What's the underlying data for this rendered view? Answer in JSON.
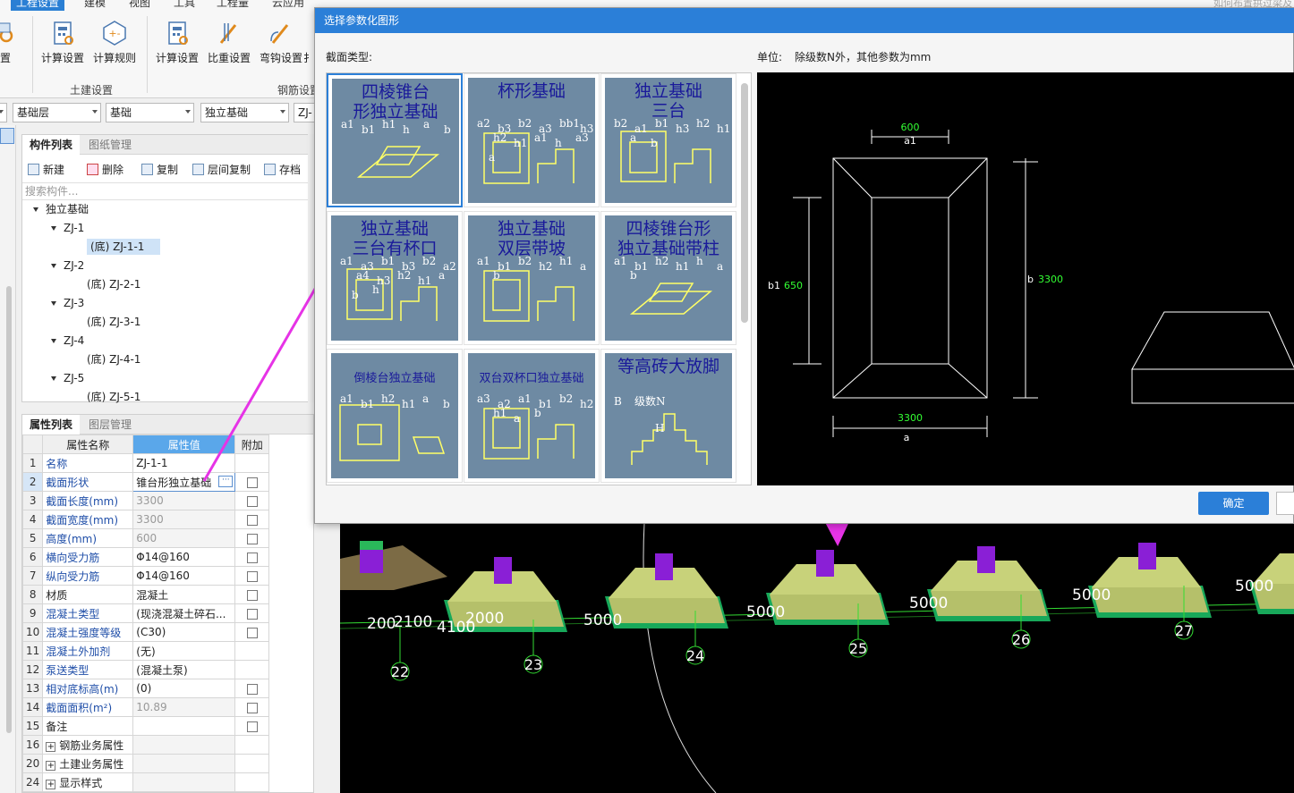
{
  "ribbon": {
    "tabs": [
      "工程设置",
      "建模",
      "视图",
      "工具",
      "工程量",
      "云应用"
    ],
    "active_tab": "工程设置",
    "partial_left": "设置",
    "buttons": [
      "计算设置",
      "计算规则",
      "计算设置",
      "比重设置",
      "弯钩设置",
      "扌"
    ],
    "group_tujian": "土建设置",
    "group_gangjin": "钢筋设置",
    "search_hint": "如何布置拱过梁及"
  },
  "combos": [
    "基础层",
    "基础",
    "独立基础",
    "ZJ-"
  ],
  "component_panel": {
    "tabs": [
      "构件列表",
      "图纸管理"
    ],
    "toolbar": [
      "新建",
      "删除",
      "复制",
      "层间复制",
      "存档"
    ],
    "search_placeholder": "搜索构件...",
    "tree": [
      {
        "label": "独立基础",
        "level": 0
      },
      {
        "label": "ZJ-1",
        "level": 1
      },
      {
        "label": "(底)  ZJ-1-1",
        "level": 2,
        "selected": true
      },
      {
        "label": "ZJ-2",
        "level": 1
      },
      {
        "label": "(底)  ZJ-2-1",
        "level": 2
      },
      {
        "label": "ZJ-3",
        "level": 1
      },
      {
        "label": "(底)  ZJ-3-1",
        "level": 2
      },
      {
        "label": "ZJ-4",
        "level": 1
      },
      {
        "label": "(底)  ZJ-4-1",
        "level": 2
      },
      {
        "label": "ZJ-5",
        "level": 1
      },
      {
        "label": "(底)  ZJ-5-1",
        "level": 2
      }
    ]
  },
  "property_panel": {
    "tabs": [
      "属性列表",
      "图层管理"
    ],
    "headers": [
      "属性名称",
      "属性值",
      "附加"
    ],
    "rows": [
      {
        "n": "1",
        "name": "名称",
        "value": "ZJ-1-1",
        "blue": true,
        "check": false,
        "gray": false
      },
      {
        "n": "2",
        "name": "截面形状",
        "value": "锥台形独立基础",
        "blue": true,
        "check": true,
        "gray": false
      },
      {
        "n": "3",
        "name": "截面长度(mm)",
        "value": "3300",
        "blue": true,
        "check": true,
        "gray": true
      },
      {
        "n": "4",
        "name": "截面宽度(mm)",
        "value": "3300",
        "blue": true,
        "check": true,
        "gray": true
      },
      {
        "n": "5",
        "name": "高度(mm)",
        "value": "600",
        "blue": true,
        "check": true,
        "gray": true
      },
      {
        "n": "6",
        "name": "横向受力筋",
        "value": "Φ14@160",
        "blue": true,
        "check": true,
        "gray": false
      },
      {
        "n": "7",
        "name": "纵向受力筋",
        "value": "Φ14@160",
        "blue": true,
        "check": true,
        "gray": false
      },
      {
        "n": "8",
        "name": "材质",
        "value": "混凝土",
        "blue": false,
        "check": true,
        "gray": false
      },
      {
        "n": "9",
        "name": "混凝土类型",
        "value": "(现浇混凝土碎石...",
        "blue": true,
        "check": true,
        "gray": false
      },
      {
        "n": "10",
        "name": "混凝土强度等级",
        "value": "(C30)",
        "blue": true,
        "check": true,
        "gray": false
      },
      {
        "n": "11",
        "name": "混凝土外加剂",
        "value": "(无)",
        "blue": true,
        "check": false,
        "gray": false
      },
      {
        "n": "12",
        "name": "泵送类型",
        "value": "(混凝土泵)",
        "blue": true,
        "check": false,
        "gray": false
      },
      {
        "n": "13",
        "name": "相对底标高(m)",
        "value": "(0)",
        "blue": true,
        "check": true,
        "gray": false
      },
      {
        "n": "14",
        "name": "截面面积(m²)",
        "value": "10.89",
        "blue": true,
        "check": true,
        "gray": true
      },
      {
        "n": "15",
        "name": "备注",
        "value": "",
        "blue": false,
        "check": true,
        "gray": false
      },
      {
        "n": "16",
        "name": "钢筋业务属性",
        "value": "",
        "blue": false,
        "check": false,
        "gray": false,
        "group": true
      },
      {
        "n": "20",
        "name": "土建业务属性",
        "value": "",
        "blue": false,
        "check": false,
        "gray": false,
        "group": true
      },
      {
        "n": "24",
        "name": "显示样式",
        "value": "",
        "blue": false,
        "check": false,
        "gray": false,
        "group": true
      }
    ]
  },
  "dialog": {
    "title": "选择参数化图形",
    "section_label": "截面类型:",
    "unit_label": "单位:",
    "unit_text": "除级数N外，其他参数为mm",
    "ok": "确定",
    "thumbnails": [
      "四棱锥台形独立基础",
      "杯形基础",
      "独立基础三台",
      "独立基础三台有杯口",
      "独立基础双层带坡",
      "四棱锥台形独立基础带柱",
      "倒棱台独立基础",
      "双台双杯口独立基础",
      "等高砖大放脚"
    ],
    "thumb_caption_lines": [
      [
        "四棱锥台",
        "形独立基础"
      ],
      [
        "杯形基础"
      ],
      [
        "独立基础",
        "三台"
      ],
      [
        "独立基础",
        "三台有杯口"
      ],
      [
        "独立基础",
        "双层带坡"
      ],
      [
        "四棱锥台形",
        "独立基础带柱"
      ],
      [
        "倒棱台独立基础"
      ],
      [
        "双台双杯口独立基础"
      ],
      [
        "等高砖大放脚"
      ]
    ],
    "thumb_labels": {
      "t1": [
        "a1",
        "b1",
        "h1",
        "h",
        "a",
        "b"
      ],
      "t2": [
        "a2",
        "b3",
        "b2",
        "a3",
        "bb1",
        "h3",
        "h2",
        "h1",
        "a1",
        "h",
        "a3",
        "a"
      ],
      "t3": [
        "b2",
        "a1",
        "b1",
        "h3",
        "h2",
        "h1",
        "a",
        "b"
      ],
      "t4": [
        "a1",
        "a3",
        "b1",
        "b3",
        "b2",
        "a2",
        "a4",
        "h3",
        "h2",
        "h1",
        "a",
        "b",
        "h"
      ],
      "t5": [
        "a1",
        "b1",
        "b2",
        "h2",
        "h1",
        "a",
        "b"
      ],
      "t6": [
        "a1",
        "b1",
        "h2",
        "h1",
        "h",
        "a",
        "b"
      ],
      "t7": [
        "a1",
        "b1",
        "h2",
        "h1",
        "a",
        "b"
      ],
      "t8": [
        "a3",
        "a2",
        "a1",
        "b1",
        "b2",
        "h2",
        "h1",
        "a",
        "b"
      ],
      "t9": [
        "B",
        "级数N",
        "H"
      ]
    },
    "preview": {
      "top_dim": "600",
      "top_dim_name": "a1",
      "left_name": "b1",
      "left_dim": "650",
      "right_name": "b",
      "right_dim": "3300",
      "bottom_dim": "3300",
      "bottom_name": "a"
    }
  },
  "viewport": {
    "dims": [
      "200",
      "2100",
      "4100",
      "2000",
      "5000",
      "5000",
      "5000",
      "5000",
      "5000"
    ],
    "axes": [
      "22",
      "23",
      "24",
      "25",
      "26",
      "27"
    ]
  },
  "colors": {
    "accent": "#2b7fd8",
    "arrow": "#e633e6",
    "dim_green": "#33ff33",
    "foundation": "#b5c06a",
    "column": "#8a1fd6"
  }
}
